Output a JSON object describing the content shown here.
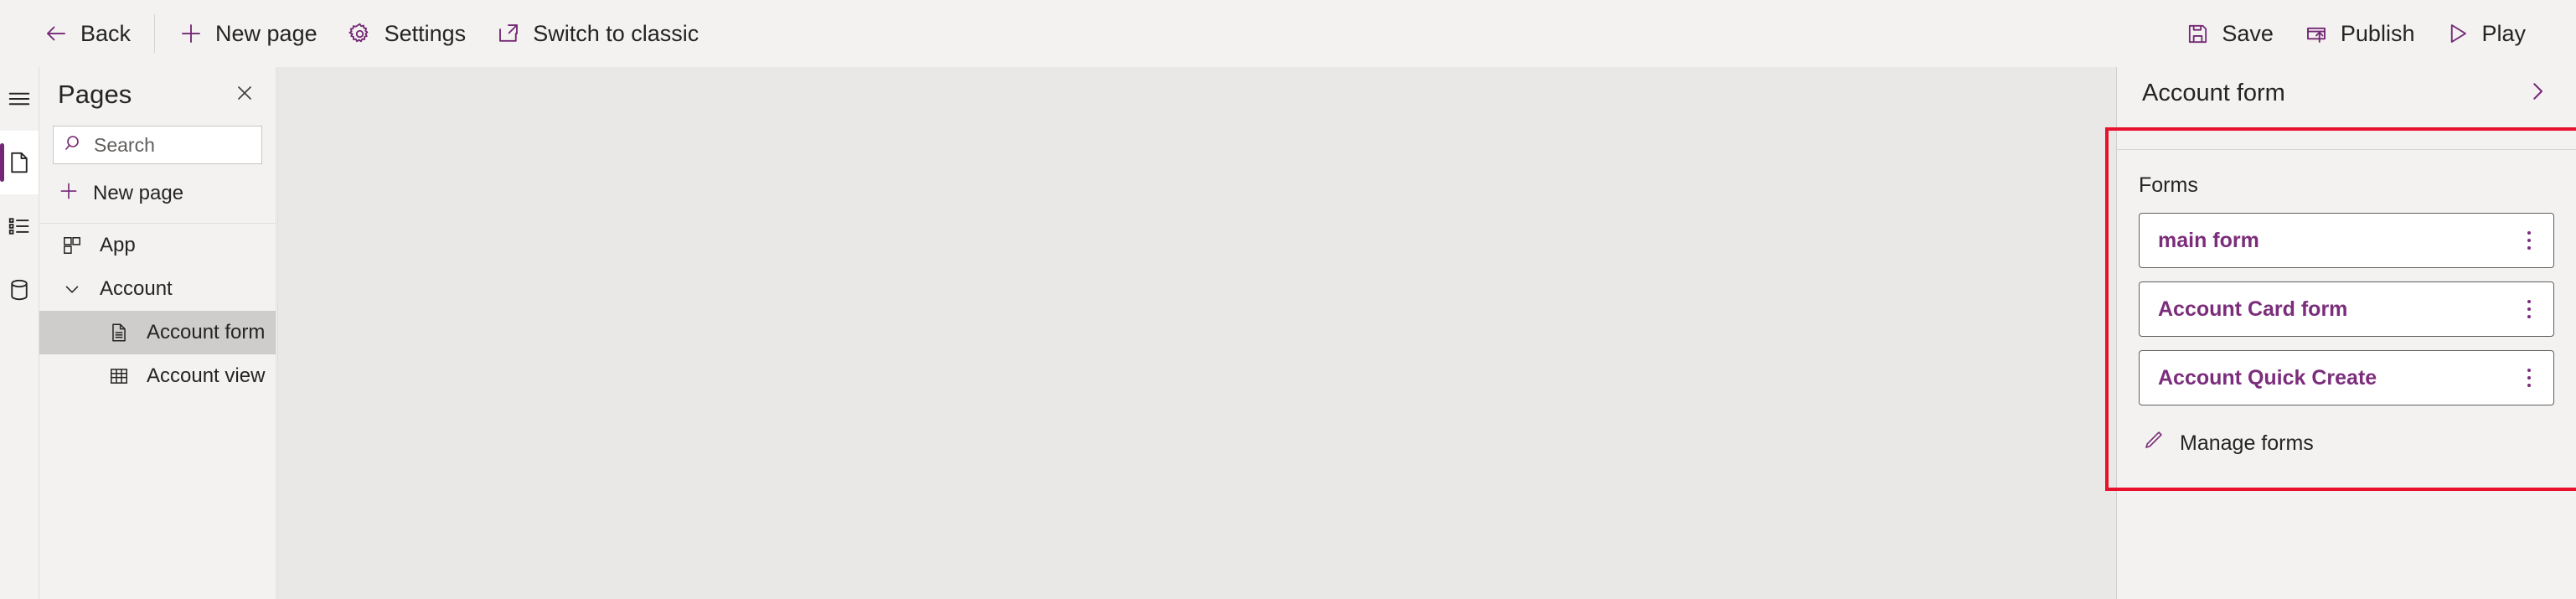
{
  "toolbar": {
    "left_items": [
      {
        "label": "Back",
        "icon": "arrow-left-icon"
      },
      {
        "label": "New page",
        "icon": "plus-icon"
      },
      {
        "label": "Settings",
        "icon": "gear-icon"
      },
      {
        "label": "Switch to classic",
        "icon": "external-link-icon"
      }
    ],
    "right_items": [
      {
        "label": "Save",
        "icon": "save-icon"
      },
      {
        "label": "Publish",
        "icon": "publish-icon"
      },
      {
        "label": "Play",
        "icon": "play-icon"
      }
    ]
  },
  "rail": {
    "items": [
      {
        "name": "hamburger-menu",
        "icon": "hamburger-icon",
        "selected": false
      },
      {
        "name": "pages",
        "icon": "page-icon",
        "selected": true
      },
      {
        "name": "navigation",
        "icon": "list-icon",
        "selected": false
      },
      {
        "name": "data",
        "icon": "database-icon",
        "selected": false
      }
    ]
  },
  "pages_panel": {
    "title": "Pages",
    "close_icon": "close-icon",
    "search": {
      "placeholder": "Search",
      "value": "",
      "icon": "search-icon"
    },
    "new_page": {
      "label": "New page",
      "icon": "plus-icon"
    },
    "tree": [
      {
        "label": "App",
        "icon": "app-grid-icon",
        "level": 1,
        "selected": false,
        "expander": null
      },
      {
        "label": "Account",
        "icon": null,
        "level": 2,
        "selected": false,
        "expander": "chevron-down-icon"
      },
      {
        "label": "Account form",
        "icon": "form-document-icon",
        "level": 3,
        "selected": true,
        "expander": null
      },
      {
        "label": "Account view",
        "icon": "table-grid-icon",
        "level": 3,
        "selected": false,
        "expander": null
      }
    ]
  },
  "right_panel": {
    "title": "Account form",
    "expand_icon": "chevron-right-icon",
    "section_label": "Forms",
    "forms": [
      {
        "label": "main form",
        "menu_icon": "more-vertical-icon"
      },
      {
        "label": "Account Card form",
        "menu_icon": "more-vertical-icon"
      },
      {
        "label": "Account Quick Create",
        "menu_icon": "more-vertical-icon"
      }
    ],
    "manage_forms": {
      "label": "Manage forms",
      "icon": "pencil-icon"
    }
  },
  "colors": {
    "accent_purple": "#742774",
    "link_purple": "#7b2d7b",
    "annotation_red": "#e8112d",
    "chrome_bg": "#f3f2f1",
    "canvas_bg": "#e9e8e6",
    "selected_row": "#cfcdcb"
  }
}
